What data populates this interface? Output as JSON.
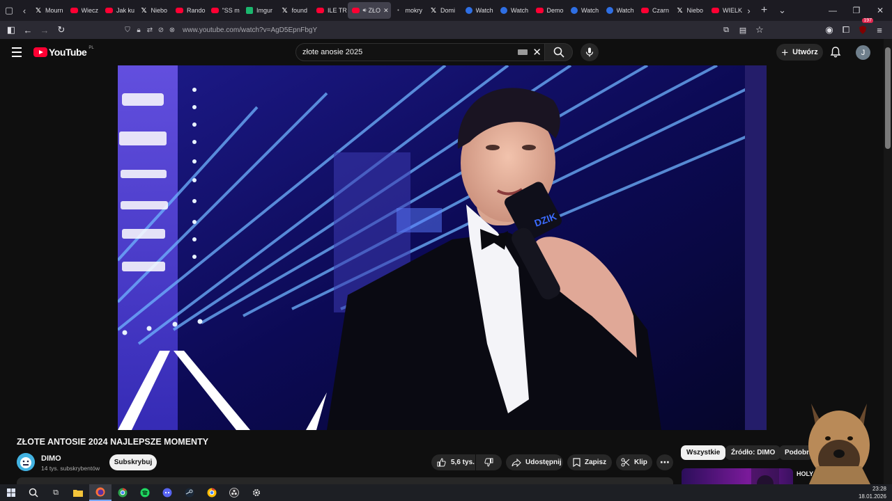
{
  "browser": {
    "tabs": [
      {
        "label": "Mourn",
        "favicon": "x-icon"
      },
      {
        "label": "Wiecz",
        "favicon": "youtube-icon"
      },
      {
        "label": "Jak ku",
        "favicon": "youtube-icon"
      },
      {
        "label": "Niebo",
        "favicon": "x-icon"
      },
      {
        "label": "Rando",
        "favicon": "youtube-icon"
      },
      {
        "label": "\"SS m",
        "favicon": "youtube-icon"
      },
      {
        "label": "Imgur",
        "favicon": "imgur-icon"
      },
      {
        "label": "found",
        "favicon": "x-icon"
      },
      {
        "label": "ILE TR",
        "favicon": "youtube-icon"
      },
      {
        "label": "ZŁO",
        "favicon": "youtube-icon",
        "active": true
      },
      {
        "label": "mokry",
        "favicon": "dot-icon"
      },
      {
        "label": "Domi",
        "favicon": "x-icon"
      },
      {
        "label": "Watch",
        "favicon": "watch-icon"
      },
      {
        "label": "Watch",
        "favicon": "watch-icon"
      },
      {
        "label": "Demo",
        "favicon": "youtube-icon"
      },
      {
        "label": "Watch",
        "favicon": "watch-icon"
      },
      {
        "label": "Watch",
        "favicon": "watch-icon"
      },
      {
        "label": "Czarn",
        "favicon": "youtube-icon"
      },
      {
        "label": "Niebo",
        "favicon": "x-icon"
      },
      {
        "label": "WIELK",
        "favicon": "youtube-icon"
      }
    ],
    "url": "www.youtube.com/watch?v=AgD5EpnFbgY",
    "extension_badge": "197"
  },
  "youtube": {
    "logo_text": "YouTube",
    "region": "PL",
    "search_query": "złote anosie 2025",
    "create_label": "Utwórz",
    "user_initial": "J"
  },
  "video": {
    "title": "ZŁOTE ANTOSIE 2024 NAJLEPSZE MOMENTY",
    "channel_name": "DIMO",
    "subscribers": "14 tys. subskrybentów",
    "subscribe_label": "Subskrybuj",
    "likes": "5,6 tys.",
    "share_label": "Udostępnij",
    "save_label": "Zapisz",
    "clip_label": "Klip",
    "mic_logo_text": "DZIK"
  },
  "sidebar": {
    "chips": [
      "Wszystkie",
      "Źródło: DIMO",
      "Podobne"
    ],
    "rec_title": "HOLY ANTO"
  },
  "system": {
    "time": "23:28",
    "date": "18.01.2026"
  },
  "colors": {
    "youtube_red": "#ff0033",
    "background": "#0f0f0f",
    "pill": "#272727"
  }
}
